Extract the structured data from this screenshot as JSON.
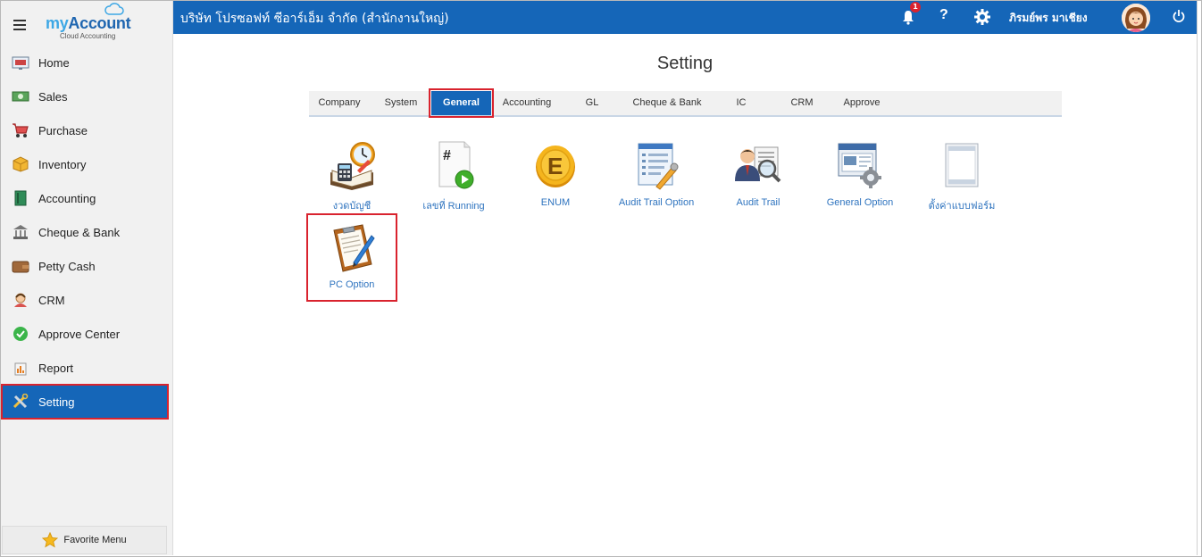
{
  "app": {
    "logo_my": "my",
    "logo_account": "Account",
    "logo_sub": "Cloud Accounting"
  },
  "sidebar": {
    "items": [
      {
        "label": "Home",
        "icon": "home-icon"
      },
      {
        "label": "Sales",
        "icon": "sales-icon"
      },
      {
        "label": "Purchase",
        "icon": "purchase-cart-icon"
      },
      {
        "label": "Inventory",
        "icon": "inventory-box-icon"
      },
      {
        "label": "Accounting",
        "icon": "accounting-book-icon"
      },
      {
        "label": "Cheque & Bank",
        "icon": "bank-icon"
      },
      {
        "label": "Petty Cash",
        "icon": "wallet-icon"
      },
      {
        "label": "CRM",
        "icon": "crm-person-icon"
      },
      {
        "label": "Approve Center",
        "icon": "approve-check-icon"
      },
      {
        "label": "Report",
        "icon": "report-icon"
      },
      {
        "label": "Setting",
        "icon": "setting-tools-icon"
      }
    ],
    "active": "Setting",
    "favorite_label": "Favorite Menu"
  },
  "topbar": {
    "company": "บริษัท โปรซอฟท์ ซีอาร์เอ็ม จำกัด (สำนักงานใหญ่)",
    "notification_count": "1",
    "help_glyph": "?",
    "username": "ภิรมย์พร มาเชียง"
  },
  "page": {
    "title": "Setting"
  },
  "tabs": [
    {
      "label": "Company"
    },
    {
      "label": "System"
    },
    {
      "label": "General"
    },
    {
      "label": "Accounting"
    },
    {
      "label": "GL"
    },
    {
      "label": "Cheque & Bank"
    },
    {
      "label": "IC"
    },
    {
      "label": "CRM"
    },
    {
      "label": "Approve"
    }
  ],
  "active_tab": "General",
  "tiles": [
    {
      "label": "งวดบัญชี",
      "icon": "accounting-period-icon"
    },
    {
      "label": "เลขที่ Running",
      "icon": "running-number-icon"
    },
    {
      "label": "ENUM",
      "icon": "enum-coin-icon"
    },
    {
      "label": "Audit Trail Option",
      "icon": "audit-trail-option-icon"
    },
    {
      "label": "Audit Trail",
      "icon": "audit-trail-icon"
    },
    {
      "label": "General Option",
      "icon": "general-option-icon"
    },
    {
      "label": "ตั้งค่าแบบฟอร์ม",
      "icon": "form-setting-icon"
    },
    {
      "label": "PC Option",
      "icon": "pc-option-clipboard-icon"
    }
  ],
  "colors": {
    "primary": "#1566b8",
    "highlight": "#d9232e",
    "link": "#2f74bf"
  }
}
